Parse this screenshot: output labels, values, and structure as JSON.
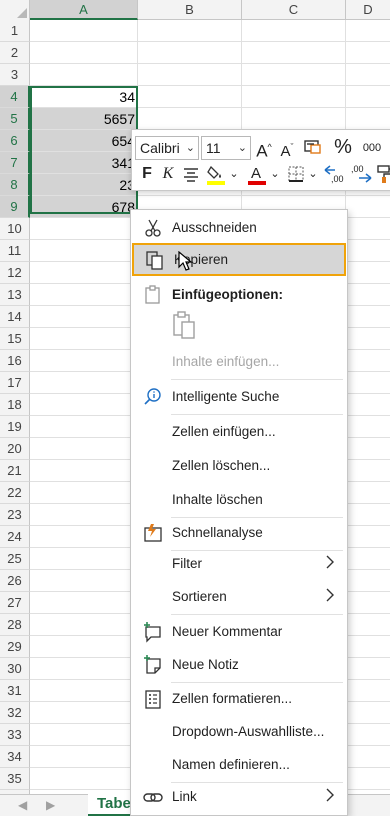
{
  "columns": [
    "A",
    "B",
    "C",
    "D"
  ],
  "rows": [
    "1",
    "2",
    "3",
    "4",
    "5",
    "6",
    "7",
    "8",
    "9",
    "10",
    "11",
    "12",
    "13",
    "14",
    "15",
    "16",
    "17",
    "18",
    "19",
    "20",
    "21",
    "22",
    "23",
    "24",
    "25",
    "26",
    "27",
    "28",
    "29",
    "30",
    "31",
    "32",
    "33",
    "34",
    "35",
    "36"
  ],
  "column_a_values": [
    "34",
    "5657",
    "654",
    "341",
    "23",
    "678"
  ],
  "toolbar": {
    "font_name": "Calibri",
    "font_size": "11",
    "bold": "F",
    "italic": "K",
    "percent": "%",
    "thousands": "000"
  },
  "context_menu": {
    "cut": "Ausschneiden",
    "copy": "Kopieren",
    "paste_options": "Einfügeoptionen:",
    "paste_special": "Inhalte einfügen...",
    "smart_lookup": "Intelligente Suche",
    "insert_cells": "Zellen einfügen...",
    "delete_cells": "Zellen löschen...",
    "clear_contents": "Inhalte löschen",
    "quick_analysis": "Schnellanalyse",
    "filter": "Filter",
    "sort": "Sortieren",
    "new_comment": "Neuer Kommentar",
    "new_note": "Neue Notiz",
    "format_cells": "Zellen formatieren...",
    "dropdown_list": "Dropdown-Auswahlliste...",
    "define_name": "Namen definieren...",
    "link": "Link"
  },
  "sheet_tab": "Tabe",
  "colors": {
    "accent": "#217346",
    "hover_border": "#f0a30a",
    "selection_fill": "#d3d3d3"
  }
}
